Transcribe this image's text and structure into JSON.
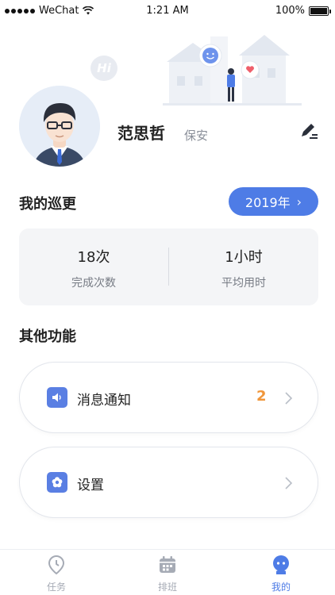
{
  "status_bar": {
    "carrier": "WeChat",
    "time": "1:21 AM",
    "battery": "100%"
  },
  "header": {
    "greeting_bubble": "Hi"
  },
  "profile": {
    "name": "范思哲",
    "role": "保安"
  },
  "patrol": {
    "title": "我的巡更",
    "year_label": "2019年",
    "stats": [
      {
        "value": "18次",
        "label": "完成次数"
      },
      {
        "value": "1小时",
        "label": "平均用时"
      }
    ]
  },
  "functions": {
    "title": "其他功能",
    "items": [
      {
        "label": "消息通知",
        "badge": "2",
        "icon": "speaker-icon"
      },
      {
        "label": "设置",
        "badge": "",
        "icon": "gear-icon"
      }
    ]
  },
  "tabbar": {
    "tabs": [
      {
        "label": "任务",
        "icon": "location-pin-icon",
        "active": false
      },
      {
        "label": "排班",
        "icon": "calendar-icon",
        "active": false
      },
      {
        "label": "我的",
        "icon": "profile-icon",
        "active": true
      }
    ]
  },
  "colors": {
    "accent": "#4e7ce6",
    "badge": "#f0963a",
    "icon_bg": "#5a7fe3"
  }
}
